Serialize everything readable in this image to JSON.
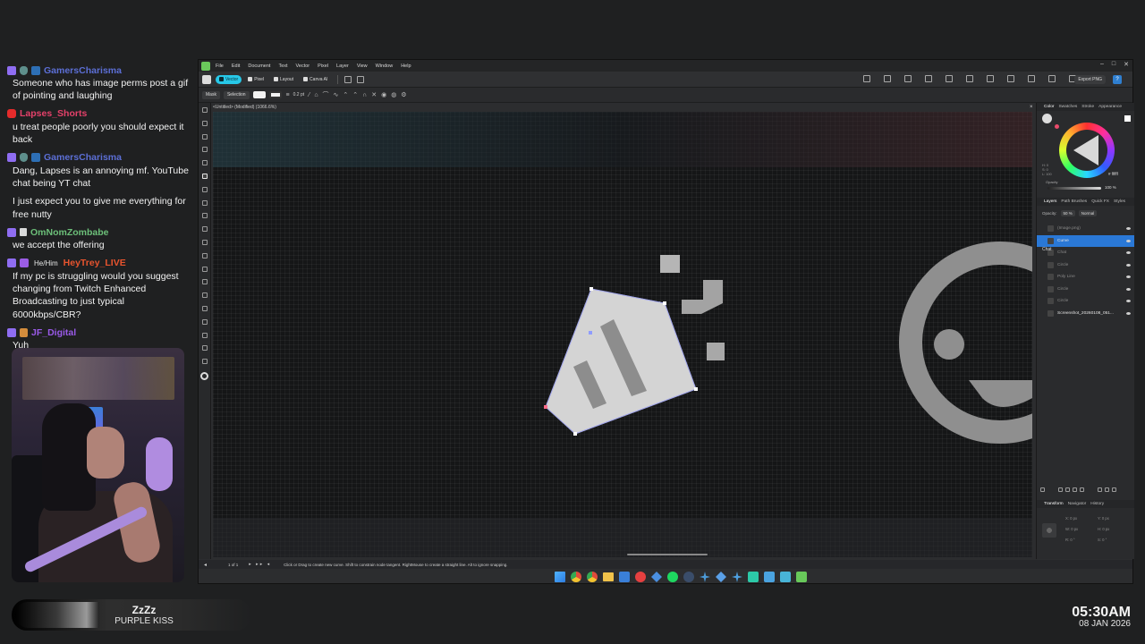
{
  "chat": [
    {
      "user": "GamersCharisma",
      "color": "#5c6fd6",
      "badges": [
        "twitch",
        "shield",
        "sub"
      ],
      "text": "Someone who has image perms post a gif of pointing and laughing"
    },
    {
      "user": "Lapses_Shorts",
      "color": "#e5416a",
      "badges": [
        "yt"
      ],
      "text": "u treat people poorly you should expect it back"
    },
    {
      "user": "GamersCharisma",
      "color": "#5c6fd6",
      "badges": [
        "twitch",
        "shield",
        "sub"
      ],
      "text": "Dang, Lapses is an annoying mf. YouTube chat being YT chat"
    },
    {
      "user": "",
      "color": "#5c6fd6",
      "badges": [],
      "text": "I just expect you to give me everything for free nutty"
    },
    {
      "user": "OmNomZombabe",
      "color": "#6cbf79",
      "badges": [
        "twitch",
        "bits"
      ],
      "text": "we accept the offering"
    },
    {
      "user": "HeyTrey_LIVE",
      "color": "#e8542e",
      "badges": [
        "twitch",
        "purple"
      ],
      "pronoun": "He/Him",
      "text": "If my pc is struggling would you suggest changing from Twitch Enhanced Broadcasting to just typical 6000kbps/CBR?"
    },
    {
      "user": "JF_Digital",
      "color": "#9a5ae8",
      "badges": [
        "twitch",
        "gift"
      ],
      "text": "Yuh"
    }
  ],
  "now_playing": {
    "title": "ZzZz",
    "artist": "PURPLE KISS"
  },
  "clock": {
    "time": "05:30AM",
    "date": "08 JAN 2026"
  },
  "app": {
    "menu": [
      "File",
      "Edit",
      "Document",
      "Text",
      "Vector",
      "Pixel",
      "Layer",
      "View",
      "Window",
      "Help"
    ],
    "personas": [
      {
        "label": "Vector",
        "active": true
      },
      {
        "label": "Pixel",
        "active": false
      },
      {
        "label": "Layout",
        "active": false
      },
      {
        "label": "Canva AI",
        "active": false
      }
    ],
    "export_label": "Export PNG",
    "help_label": "?",
    "context": {
      "mask": "Mask",
      "selection": "Selection",
      "stroke_width": "0.2 pt"
    },
    "doc_tab": "<Untitled> (Modified) (1066.6%)",
    "doc_close": "×",
    "status": {
      "page": "1 of 1",
      "nav": "▸ ▸▸ ◂",
      "hint": "Click or Drag to create new curve. Shift to constrain node tangent. RightMouse to create a straight line. Alt to ignore snapping."
    },
    "color_panel": {
      "tabs": [
        "Color",
        "Swatches",
        "Stroke",
        "Appearance"
      ],
      "hex": "# ffffff",
      "opacity_label": "Opacity",
      "opacity": "100 %",
      "hsl": "H: 0\nS: 0\nL: 100"
    },
    "layers_panel": {
      "tabs": [
        "Layers",
        "Path Brushes",
        "Quick FX",
        "Styles"
      ],
      "opacity_label": "Opacity:",
      "opacity": "50 %",
      "blend": "Normal",
      "chat_label": "Chat",
      "layers": [
        {
          "name": "(Image.png)",
          "selected": false,
          "bright": false
        },
        {
          "name": "Curve",
          "selected": true,
          "bright": true
        },
        {
          "name": "Chat",
          "selected": false,
          "bright": false
        },
        {
          "name": "Circle",
          "selected": false,
          "bright": false
        },
        {
          "name": "Poly Line",
          "selected": false,
          "bright": false
        },
        {
          "name": "Circle",
          "selected": false,
          "bright": false
        },
        {
          "name": "Circle",
          "selected": false,
          "bright": false
        },
        {
          "name": "Screenshot_20260108_051...",
          "selected": false,
          "bright": true
        }
      ]
    },
    "transform_panel": {
      "tabs": [
        "Transform",
        "Navigator",
        "History"
      ],
      "fields": [
        "X: 0 px",
        "Y: 0 px",
        "W: 0 px",
        "H: 0 px",
        "R: 0 °",
        "S: 0 °"
      ]
    }
  }
}
